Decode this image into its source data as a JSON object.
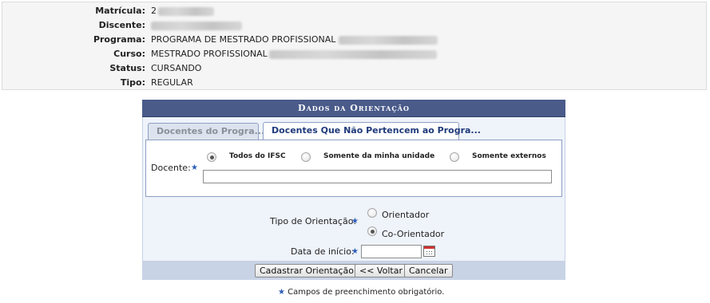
{
  "student": {
    "rows": [
      {
        "label": "Matrícula:",
        "value": "2"
      },
      {
        "label": "Discente:",
        "value": ""
      },
      {
        "label": "Programa:",
        "value": "PROGRAMA DE MESTRADO PROFISSIONAL"
      },
      {
        "label": "Curso:",
        "value": "MESTRADO PROFISSIONAL"
      },
      {
        "label": "Status:",
        "value": "CURSANDO"
      },
      {
        "label": "Tipo:",
        "value": "REGULAR"
      }
    ]
  },
  "panel": {
    "title": "Dados da Orientação",
    "tabs": [
      {
        "label": "Docentes do Progra...",
        "active": false
      },
      {
        "label": "Docentes Que Não Pertencem ao Progra...",
        "active": true
      }
    ],
    "docente": {
      "label": "Docente:",
      "options": [
        {
          "label": "Todos do IFSC",
          "selected": true
        },
        {
          "label": "Somente da minha unidade",
          "selected": false
        },
        {
          "label": "Somente externos",
          "selected": false
        }
      ],
      "value": ""
    },
    "tipo": {
      "label": "Tipo de Orientação:",
      "options": [
        {
          "label": "Orientador",
          "selected": false
        },
        {
          "label": "Co-Orientador",
          "selected": true
        }
      ]
    },
    "data_inicio": {
      "label": "Data de início:",
      "value": ""
    },
    "buttons": {
      "submit": "Cadastrar Orientação",
      "back": "<< Voltar",
      "cancel": "Cancelar"
    }
  },
  "footer": {
    "required_note": "Campos de preenchimento obrigatório."
  },
  "colors": {
    "caption_bg": "#4a5b8a",
    "tab_active_text": "#1f3a7a",
    "required_star": "#2b5db8"
  }
}
